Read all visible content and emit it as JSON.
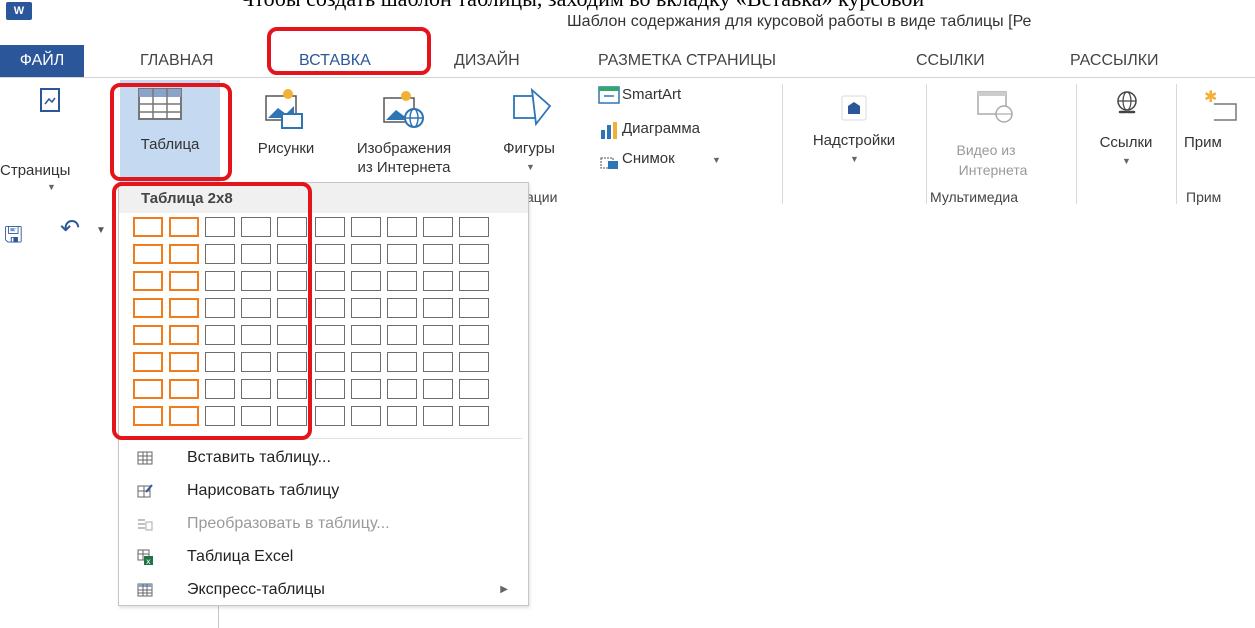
{
  "document": {
    "top_text": "Чтобы создать шаблон таблицы, заходим во вкладку «Вставка» курсовой"
  },
  "title_bar": {
    "app_logo": "W",
    "window_title": "Шаблон содержания для курсовой работы в виде таблицы [Ре"
  },
  "tabs": [
    {
      "label": "ФАЙЛ"
    },
    {
      "label": "ГЛАВНАЯ"
    },
    {
      "label": "ВСТАВКА",
      "active": true
    },
    {
      "label": "ДИЗАЙН"
    },
    {
      "label": "РАЗМЕТКА СТРАНИЦЫ"
    },
    {
      "label": "ССЫЛКИ"
    },
    {
      "label": "РАССЫЛКИ"
    }
  ],
  "ribbon": {
    "pages": "Страницы",
    "table": "Таблица",
    "pictures": "Рисунки",
    "online_pictures_1": "Изображения",
    "online_pictures_2": "из Интернета",
    "shapes": "Фигуры",
    "smartart": "SmartArt",
    "chart": "Диаграмма",
    "screenshot": "Снимок",
    "addins": "Надстройки",
    "online_video_1": "Видео из",
    "online_video_2": "Интернета",
    "links": "Ссылки",
    "comments": "Прим",
    "group_illustrations": "ации",
    "group_media": "Мультимедиа",
    "group_comments": "Прим"
  },
  "table_dropdown": {
    "title": "Таблица 2x8",
    "grid_columns": 10,
    "grid_rows": 8,
    "selected_columns": 2,
    "selected_rows": 8,
    "menu": [
      {
        "label": "Вставить таблицу...",
        "icon": "insert-table-icon",
        "enabled": true
      },
      {
        "label": "Нарисовать таблицу",
        "icon": "draw-table-icon",
        "enabled": true
      },
      {
        "label": "Преобразовать в таблицу...",
        "icon": "convert-text-to-table-icon",
        "enabled": false
      },
      {
        "label": "Таблица Excel",
        "icon": "excel-table-icon",
        "enabled": true
      },
      {
        "label": "Экспресс-таблицы",
        "icon": "quick-tables-icon",
        "enabled": true,
        "submenu": true
      }
    ]
  },
  "colors": {
    "accent": "#2b579a",
    "highlight_box": "#e4141b",
    "grid_selection": "#f07d1d",
    "button_pressed": "#c5d9f0"
  }
}
